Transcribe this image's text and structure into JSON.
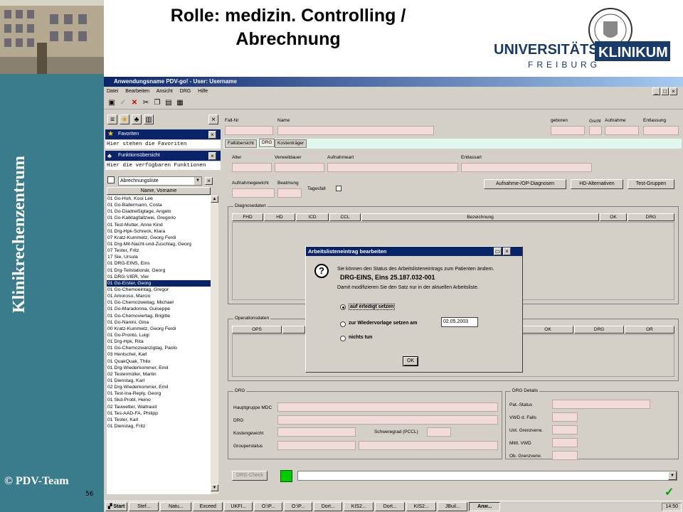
{
  "slide": {
    "title": "Rolle: medizin. Controlling / Abrechnung",
    "title_line1": "Rolle: medizin. Controlling /",
    "title_line2": "Abrechnung",
    "vertical_title": "Klinikrechenzentrum",
    "copyright": "© PDV-Team",
    "page_number": "56",
    "logo": {
      "word1": "UNIVERSITÄTS",
      "word2": "KLINIKUM",
      "city": "FREIBURG"
    }
  },
  "window": {
    "title": "Anwendungsname PDV-go! - User: Username",
    "menu": [
      "Datei",
      "Bearbeiten",
      "Ansicht",
      "DRG",
      "Hilfe"
    ]
  },
  "left_panel": {
    "favorites_title": "Favoriten",
    "favorites_text": "Hier stehen die Favoriten",
    "functions_title": "Funktionsübersicht",
    "functions_text": "Hier die verfügbaren Funktionen",
    "list_select": "Abrechnungsliste",
    "column_header": "Name, Vorname",
    "patients": [
      "01 Go-Hoh, Kooi Lee",
      "01 Go-Ballermann, Costa",
      "01 Go-Diadreißigtage, Angelo",
      "01 Go-Kalktagfallzwei, Gregorio",
      "01 Test-Mutter, Anne Kind",
      "01 Drg-Hpk-Schreck, Klara",
      "07 Kratz-Kummetz, Georg Ferdi",
      "01 Drg-Mit-Nacht-und-Zuschlag, Georg",
      "07 Tester, Fritz",
      "17 Sie, Ursula",
      "01 DRG-EINS, Eins",
      "01 Drg-Teilstationär, Georg",
      "01 DRG-VIER, Vier",
      "01 Go-Erster, Georg",
      "01 Go-Chemoeintag, Gregor",
      "01 Amoroso, Marcio",
      "01 Go-Chemozweitag, Michael",
      "01 Go-Maradonna, Guiseppe",
      "01 Go-Chemoviertag, Brigitte",
      "01 Go-Nanini, Gina",
      "00 Kratz-Kummetz, Georg Ferdi",
      "01 Go-Pronto, Luigi",
      "01 Drg-Hpk, Rita",
      "01 Go-Chemozwanzigtag, Paolo",
      "03 Hentschel, Karl",
      "01 QuakQuak, Thilo",
      "01 Drg-Wiederkommer, Emil",
      "02 Testermüller, Martin",
      "01 Dienstag, Karl",
      "02 Drg-Wiederkommer, Emil",
      "01 Test-Ina-Reply, Georg",
      "01 Skd-Probl, Heino",
      "02 Tauwetter, Waltraud",
      "01 Tes-AAD-FA, Philipp",
      "01 Tester, Karl",
      "01 Dienstag, Fritz"
    ],
    "selected_index": 13
  },
  "form": {
    "labels": {
      "fall_nr": "Fall-Nr",
      "name": "Name",
      "geboren": "geboren",
      "geschl": "Gschl",
      "aufnahme": "Aufnahme",
      "entlassung": "Entlassung",
      "alter": "Alter",
      "verweildauer": "Verweildauer",
      "aufnahmeart": "Aufnahmeart",
      "entlassart": "Entlassart",
      "aufnahmegewicht": "Aufnahmegewicht",
      "beatmung": "Beatmung",
      "tagesfall": "Tagesfall"
    },
    "tabs": [
      "Fallübersicht",
      "DRG",
      "Kostenträger"
    ],
    "buttons": {
      "diagnosen": "Aufnahme-/OP-Diagnosen",
      "hd_alt": "HD-Alternativen",
      "test_gruppen": "Test-Gruppen",
      "drg_check": "DRG-Check"
    },
    "diagnose": {
      "group": "Diagnosedaten",
      "columns": [
        "FHD",
        "HD",
        "ICD",
        "CCL",
        "Bezeichnung",
        "OK",
        "DRG"
      ]
    },
    "operation": {
      "group": "Operationsdaten",
      "columns": [
        "OPS",
        "OK",
        "DRG",
        "OR"
      ]
    },
    "drg": {
      "group": "DRG",
      "hauptgruppe": "Hauptgruppe MDC",
      "drg": "DRG",
      "kostengewicht": "Kostengewicht",
      "schweregrad": "Schweregrad (PCCL)",
      "grouperstatus": "Grouperstatus"
    },
    "drg_details": {
      "group": "DRG Details",
      "pat_status": "Pat.-Status",
      "vwd": "VWD d. Falls",
      "unt": "Unt. Grenzverw.",
      "mittl": "Mittl. VWD",
      "ob": "Ob. Grenzverw."
    }
  },
  "dialog": {
    "title": "Arbeitslisteneintrag bearbeiten",
    "line1": "Sie können den Status des Arbeitslisteneintrags zum Patienten ändern.",
    "patient": "DRG-EINS, Eins   25.187.032-001",
    "line2": "Damit modifizieren Sie den Satz nur in der aktuellen Arbeitsliste.",
    "option1": "auf erledigt setzen",
    "option2": "zur Wiedervorlage setzen am",
    "option3": "nichts tun",
    "date": "02.05.2003",
    "ok": "OK"
  },
  "taskbar": {
    "start": "Start",
    "tasks": [
      "Stef...",
      "Natu...",
      "Exceed",
      "UKFI...",
      "O:\\P...",
      "O:\\P...",
      "Dort...",
      "KIS2...",
      "Dort...",
      "KIS2...",
      "JBuil...",
      "Anw..."
    ],
    "clock": "14:50"
  },
  "colors": {
    "sidebar": "#3b7c8c",
    "titlebar": "#0a246a",
    "field": "#f2dcd8",
    "green_status": "#00cc00"
  }
}
